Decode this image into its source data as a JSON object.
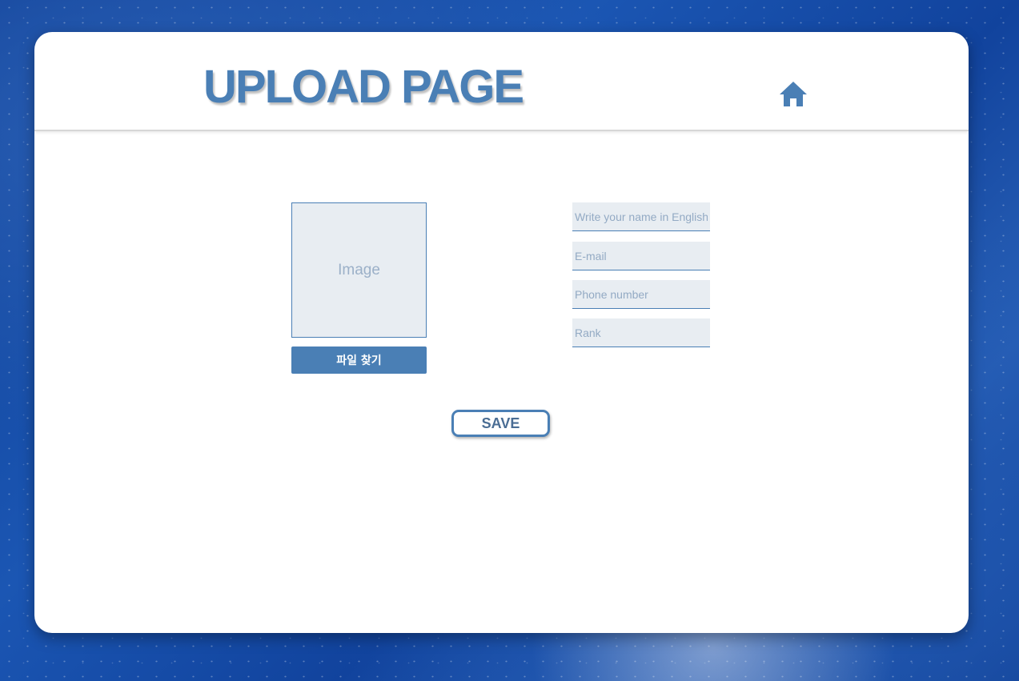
{
  "header": {
    "title": "UPLOAD PAGE",
    "home_icon": "home-icon"
  },
  "image_upload": {
    "placeholder_label": "Image",
    "find_file_label": "파일 찾기"
  },
  "form": {
    "name_placeholder": "Write your name in English",
    "email_placeholder": "E-mail",
    "phone_placeholder": "Phone number",
    "rank_placeholder": "Rank",
    "name_value": "",
    "email_value": "",
    "phone_value": "",
    "rank_value": ""
  },
  "actions": {
    "save_label": "SAVE"
  },
  "colors": {
    "accent": "#4a7fb5",
    "field_bg": "#e8edf2",
    "placeholder": "#93aac4"
  }
}
